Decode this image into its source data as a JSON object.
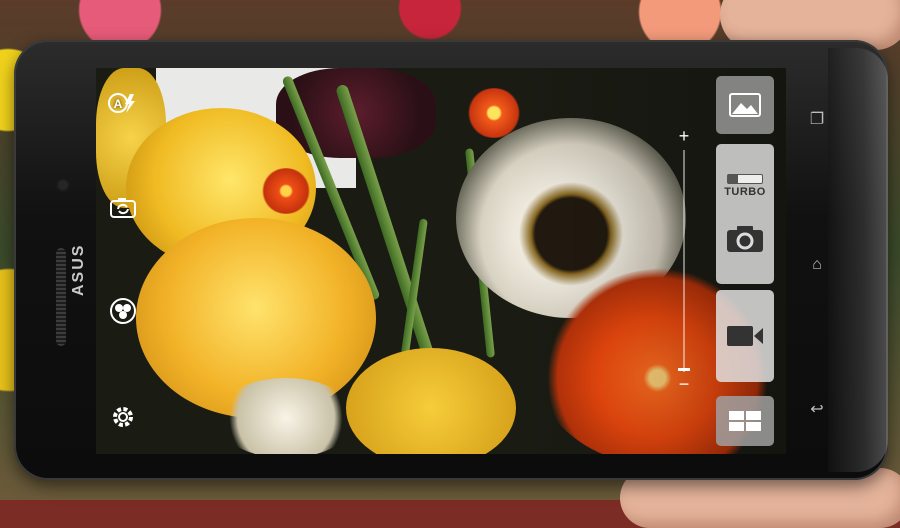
{
  "device": {
    "brand": "ASUS"
  },
  "camera_ui": {
    "left_icons": [
      {
        "name": "auto-flash-icon",
        "glyph": "Ⓐϟ"
      },
      {
        "name": "switch-camera-icon",
        "glyph": "⟲"
      },
      {
        "name": "shooting-mode-icon",
        "glyph": "◔"
      },
      {
        "name": "settings-icon",
        "glyph": "⚙"
      }
    ],
    "zoom": {
      "plus": "+",
      "minus": "−",
      "level": 0.0
    },
    "right_controls": {
      "gallery_icon": "gallery-icon",
      "turbo_label": "TURBO",
      "shutter_icon": "camera-shutter-icon",
      "video_icon": "video-record-icon",
      "mode_icon": "grid-mode-icon"
    }
  },
  "nav_keys": {
    "recent": "❐",
    "home": "⌂",
    "back": "↩"
  },
  "colors": {
    "bezel": "#0c0c0c",
    "control_bg": "#dcdcdc",
    "icon": "#333333"
  }
}
